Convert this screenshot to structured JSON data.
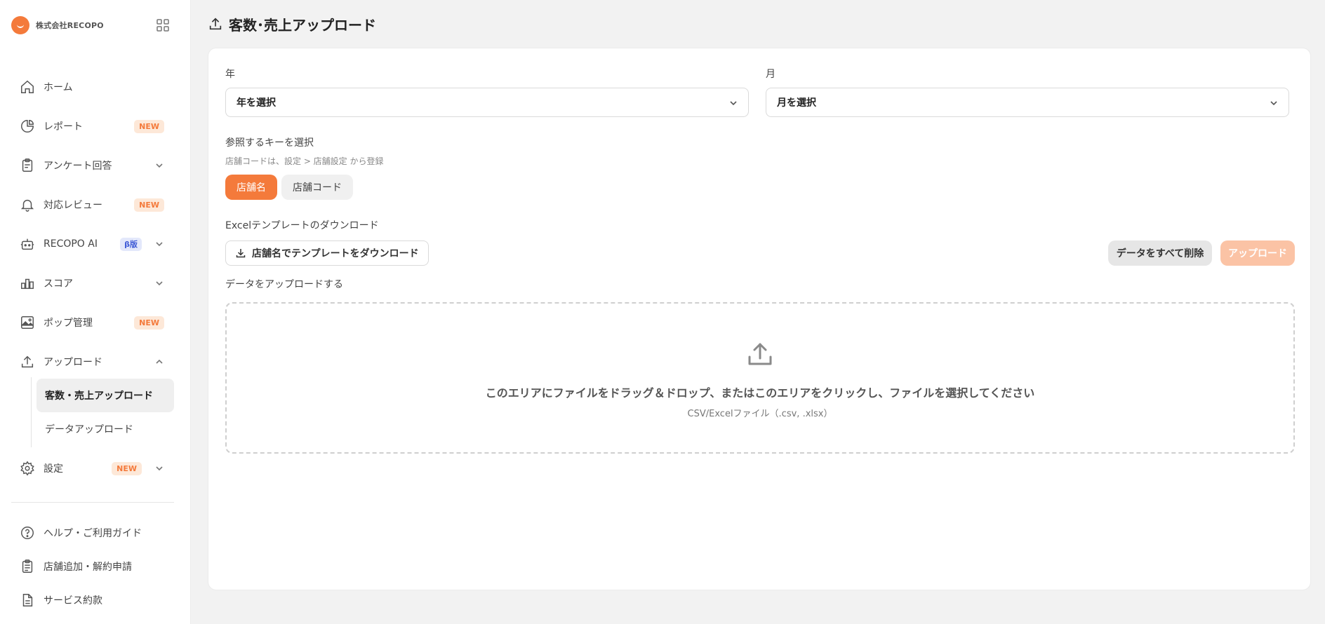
{
  "sidebar": {
    "company": "株式会社RECOPO",
    "items": [
      {
        "label": "ホーム",
        "icon": "home-icon"
      },
      {
        "label": "レポート",
        "icon": "report-icon",
        "badge": "NEW"
      },
      {
        "label": "アンケート回答",
        "icon": "clipboard-icon"
      },
      {
        "label": "対応レビュー",
        "icon": "bell-icon",
        "badge": "NEW"
      },
      {
        "label": "RECOPO AI",
        "icon": "robot-icon",
        "badge": "β版"
      },
      {
        "label": "スコア",
        "icon": "bar-chart-icon"
      },
      {
        "label": "ポップ管理",
        "icon": "image-icon",
        "badge": "NEW"
      },
      {
        "label": "アップロード",
        "icon": "upload-icon"
      },
      {
        "label": "設定",
        "icon": "gear-icon",
        "badge": "NEW"
      }
    ],
    "upload_sub": [
      {
        "label": "客数・売上アップロード"
      },
      {
        "label": "データアップロード"
      }
    ],
    "footer": [
      {
        "label": "ヘルプ・ご利用ガイド",
        "icon": "help-icon"
      },
      {
        "label": "店舗追加・解約申請",
        "icon": "clipboard-list-icon"
      },
      {
        "label": "サービス約款",
        "icon": "document-icon"
      }
    ]
  },
  "page": {
    "title": "客数･売上アップロード"
  },
  "form": {
    "year_label": "年",
    "year_value": "年を選択",
    "month_label": "月",
    "month_value": "月を選択",
    "key_label": "参照するキーを選択",
    "key_hint": "店舗コードは、設定 > 店舗設定 から登録",
    "key_options": [
      "店舗名",
      "店舗コード"
    ],
    "template_label": "Excelテンプレートのダウンロード",
    "template_button": "店舗名でテンプレートをダウンロード",
    "delete_all_button": "データをすべて削除",
    "upload_button": "アップロード",
    "dropzone_label": "データをアップロードする",
    "dropzone_main": "このエリアにファイルをドラッグ＆ドロップ、またはこのエリアをクリックし、ファイルを選択してください",
    "dropzone_sub": "CSV/Excelファイル（.csv, .xlsx）"
  },
  "colors": {
    "accent": "#f47a3b",
    "accent_light": "#fbc3a5",
    "badge_new_bg": "#fde8d8",
    "beta_bg": "#e3e8fb",
    "beta_text": "#3f5bd6"
  }
}
